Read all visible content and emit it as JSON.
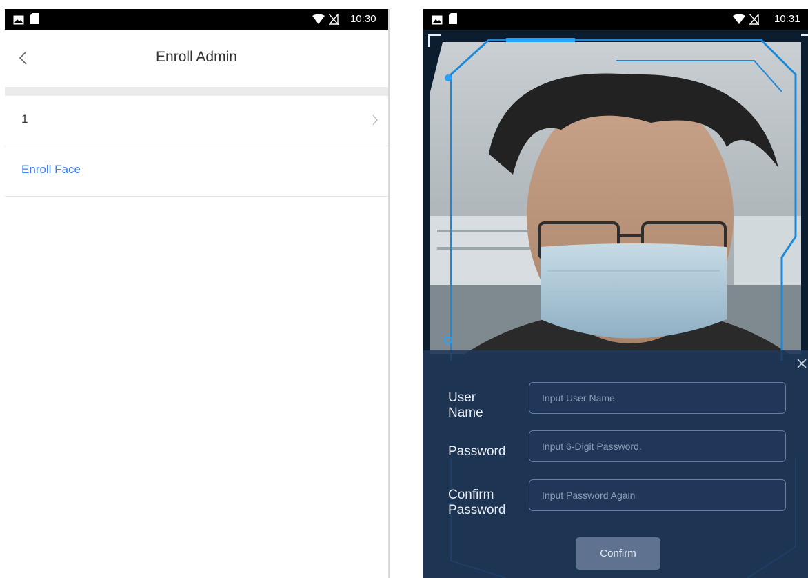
{
  "left_screen": {
    "status_bar": {
      "time": "10:30",
      "icons": [
        "image-icon",
        "sd-card-icon",
        "wifi-icon",
        "no-sim-icon"
      ]
    },
    "header": {
      "title": "Enroll Admin",
      "back_icon": "back-chevron-icon"
    },
    "list": [
      {
        "label": "1",
        "icon": "chevron-right-icon"
      },
      {
        "label": "Enroll Face"
      }
    ],
    "colors": {
      "link": "#3c7df0",
      "divider": "#e2e2e2",
      "section_gap": "#ebebeb"
    }
  },
  "right_screen": {
    "status_bar": {
      "time": "10:31",
      "icons": [
        "image-icon",
        "sd-card-icon",
        "wifi-icon",
        "no-sim-icon"
      ]
    },
    "camera": {
      "content": "live camera preview with blue face-scan frame"
    },
    "form": {
      "user_name": {
        "label": "User Name",
        "placeholder": "Input User Name"
      },
      "password": {
        "label": "Password",
        "placeholder": "Input 6-Digit Password."
      },
      "confirm_password": {
        "label": "Confirm Password",
        "placeholder": "Input Password Again"
      },
      "confirm_label": "Confirm",
      "close_icon": "close-icon"
    },
    "colors": {
      "overlay": "#21385a",
      "frame": "#1e88d6",
      "button": "#5f7290"
    }
  }
}
